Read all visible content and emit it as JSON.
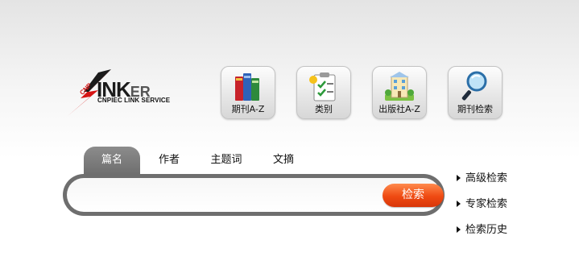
{
  "logo": {
    "brand_main": "INK",
    "brand_small": "ER",
    "tagline": "CNPIEC LINK SERVICE",
    "mark": "CNP"
  },
  "nav": [
    {
      "label": "期刊A-Z",
      "icon": "books-icon"
    },
    {
      "label": "类别",
      "icon": "clipboard-icon"
    },
    {
      "label": "出版社A-Z",
      "icon": "building-icon"
    },
    {
      "label": "期刊检索",
      "icon": "magnifier-icon"
    }
  ],
  "search": {
    "tabs": [
      "篇名",
      "作者",
      "主题词",
      "文摘"
    ],
    "active_tab": "篇名",
    "input_value": "",
    "button_label": "检索"
  },
  "links": {
    "advanced": "高级检索",
    "expert": "专家检索",
    "history": "检索历史"
  },
  "colors": {
    "search_button": "#ef4a12",
    "frame": "#6e6e6e",
    "logo_red": "#d61414"
  }
}
